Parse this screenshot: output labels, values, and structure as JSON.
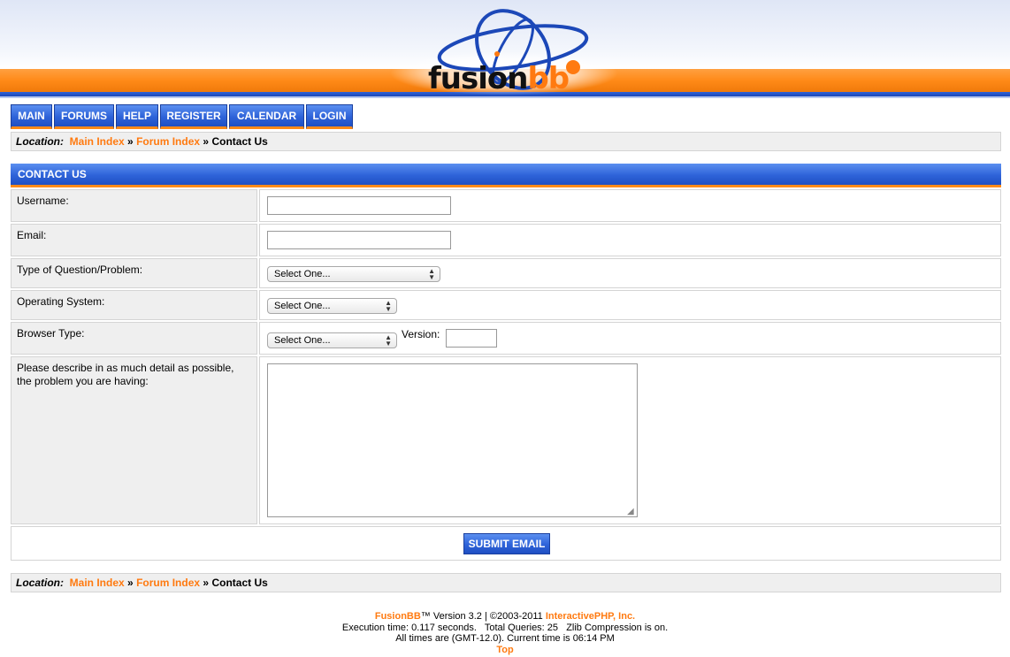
{
  "header": {
    "logo_part1": "fusion",
    "logo_part2": "bb"
  },
  "nav": {
    "items": [
      "MAIN",
      "FORUMS",
      "HELP",
      "REGISTER",
      "CALENDAR",
      "LOGIN"
    ]
  },
  "location": {
    "label": "Location:",
    "crumbs": [
      "Main Index",
      "Forum Index"
    ],
    "separator": "»",
    "current": "Contact Us"
  },
  "form": {
    "title": "CONTACT US",
    "username_label": "Username:",
    "username_value": "",
    "email_label": "Email:",
    "email_value": "",
    "question_label": "Type of Question/Problem:",
    "question_selected": "Select One...",
    "os_label": "Operating System:",
    "os_selected": "Select One...",
    "browser_label": "Browser Type:",
    "browser_selected": "Select One...",
    "version_label": "Version:",
    "version_value": "",
    "description_label": "Please describe in as much detail as possible, the problem you are having:",
    "description_value": "",
    "submit_label": "SUBMIT EMAIL"
  },
  "footer": {
    "brand": "FusionBB",
    "trademark_version": "™ Version 3.2 | ©2003-2011 ",
    "company": "InteractivePHP, Inc.",
    "line2": "Execution time: 0.117 seconds.   Total Queries: 25   Zlib Compression is on.",
    "line3": "All times are (GMT-12.0). Current time is 06:14 PM",
    "top_link": "Top"
  },
  "colors": {
    "accent_orange": "#ff7a10",
    "nav_blue": "#2e63d9",
    "panel_gray": "#efefef"
  }
}
